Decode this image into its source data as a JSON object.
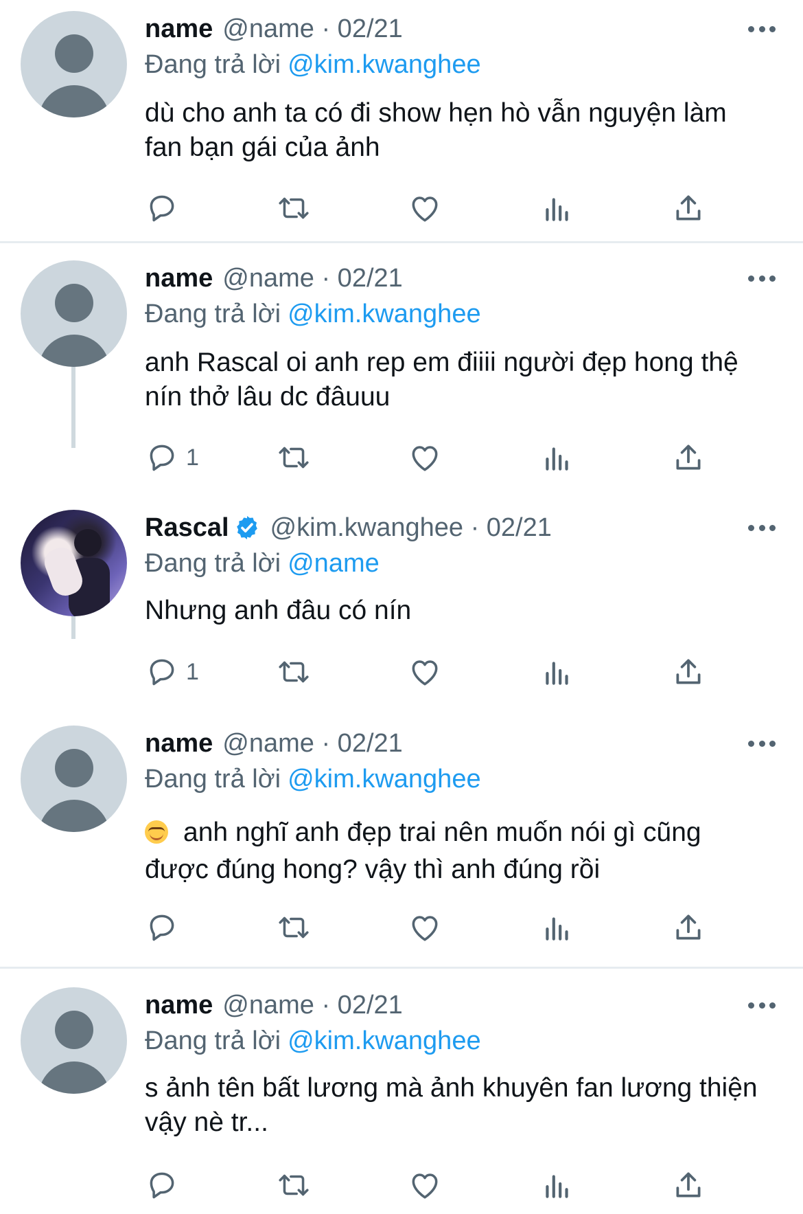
{
  "colors": {
    "text_primary": "#0f1419",
    "text_secondary": "#536471",
    "accent_link": "#1d9bf0",
    "divider": "#e6ecf0",
    "thread_line": "#cfd9de",
    "avatar_placeholder": "#ccd6dd"
  },
  "icons": {
    "reply": "reply-icon",
    "retweet": "retweet-icon",
    "like": "heart-icon",
    "views": "analytics-icon",
    "share": "share-icon",
    "more": "more-icon",
    "verified": "verified-badge-icon"
  },
  "tweets": [
    {
      "display_name": "name",
      "handle_meta": "@name · 02/21",
      "reply_prefix": "Đang trả lời",
      "reply_to": "@kim.kwanghee",
      "text": "dù cho anh ta có đi show hẹn hò vẫn nguyện làm fan bạn gái của ảnh",
      "reply_count": ""
    },
    {
      "display_name": "name",
      "handle_meta": "@name · 02/21",
      "reply_prefix": "Đang trả lời",
      "reply_to": "@kim.kwanghee",
      "text": "anh Rascal oi anh rep em điiii người đẹp hong thệ nín thở lâu dc đâuuu",
      "reply_count": "1"
    },
    {
      "display_name": "Rascal",
      "verified": true,
      "handle_meta": "@kim.kwanghee · 02/21",
      "reply_prefix": "Đang trả lời",
      "reply_to": "@name",
      "text": "Nhưng anh đâu có nín",
      "reply_count": "1"
    },
    {
      "display_name": "name",
      "handle_meta": "@name · 02/21",
      "reply_prefix": "Đang trả lời",
      "reply_to": "@kim.kwanghee",
      "emoji": "smiling-face-icon",
      "text": "anh nghĩ anh đẹp trai nên muốn nói gì cũng được đúng hong? vậy thì anh đúng rồi",
      "reply_count": ""
    },
    {
      "display_name": "name",
      "handle_meta": "@name · 02/21",
      "reply_prefix": "Đang trả lời",
      "reply_to": "@kim.kwanghee",
      "text": "s ảnh tên bất lương mà ảnh khuyên fan lương thiện vậy nè tr...",
      "reply_count": ""
    }
  ]
}
